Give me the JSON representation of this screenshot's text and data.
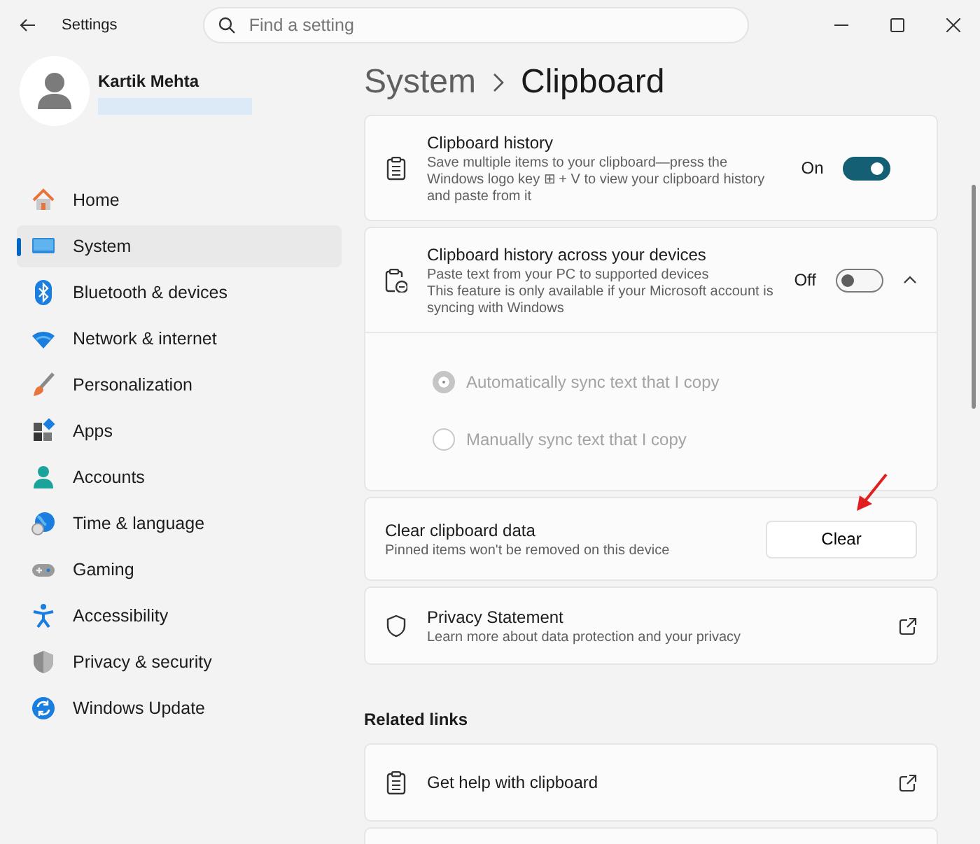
{
  "window": {
    "title": "Settings",
    "search": {
      "placeholder": "Find a setting"
    }
  },
  "profile": {
    "name": "Kartik Mehta"
  },
  "sidebar": {
    "items": [
      {
        "label": "Home",
        "selected": false
      },
      {
        "label": "System",
        "selected": true
      },
      {
        "label": "Bluetooth & devices",
        "selected": false
      },
      {
        "label": "Network & internet",
        "selected": false
      },
      {
        "label": "Personalization",
        "selected": false
      },
      {
        "label": "Apps",
        "selected": false
      },
      {
        "label": "Accounts",
        "selected": false
      },
      {
        "label": "Time & language",
        "selected": false
      },
      {
        "label": "Gaming",
        "selected": false
      },
      {
        "label": "Accessibility",
        "selected": false
      },
      {
        "label": "Privacy & security",
        "selected": false
      },
      {
        "label": "Windows Update",
        "selected": false
      }
    ]
  },
  "breadcrumb": [
    "System",
    "Clipboard"
  ],
  "cards": [
    {
      "kind": "toggle",
      "title": "Clipboard history",
      "description": [
        "Save multiple items to your clipboard—press the Windows logo key ⊞ + V to view your clipboard history and paste from it"
      ],
      "state_label": "On",
      "on": true
    },
    {
      "kind": "toggle",
      "title": "Clipboard history across your devices",
      "description": [
        "Paste text from your PC to supported devices",
        "This feature is only available if your Microsoft account is syncing with Windows"
      ],
      "state_label": "Off",
      "on": false,
      "expanded": true,
      "options": [
        {
          "label": "Automatically sync text that I copy",
          "selected": true,
          "disabled": true
        },
        {
          "label": "Manually sync text that I copy",
          "selected": false,
          "disabled": true
        }
      ]
    },
    {
      "kind": "button",
      "title": "Clear clipboard data",
      "description": [
        "Pinned items won't be removed on this device"
      ],
      "button": "Clear"
    },
    {
      "kind": "link",
      "title": "Privacy Statement",
      "description": [
        "Learn more about data protection and your privacy"
      ]
    }
  ],
  "related_links": {
    "heading": "Related links",
    "items": [
      {
        "title": "Get help with clipboard"
      }
    ]
  }
}
